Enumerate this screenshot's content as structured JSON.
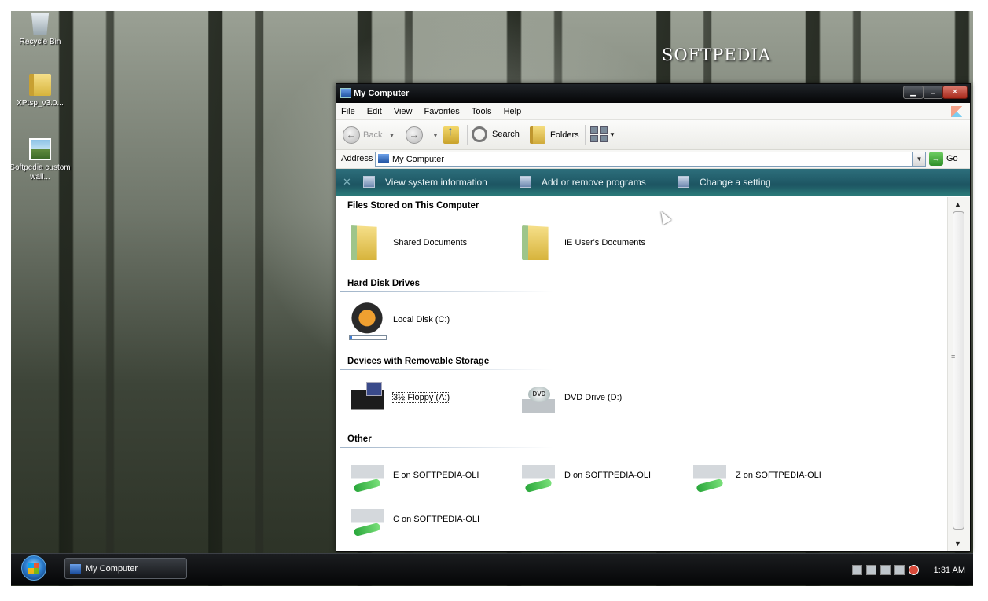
{
  "desktop": {
    "icons": [
      {
        "label": "Recycle Bin",
        "icon": "recycle-bin-icon"
      },
      {
        "label": "XPtsp_v3.0...",
        "icon": "zip-folder-icon"
      },
      {
        "label": "Softpedia custom wall...",
        "icon": "image-file-icon"
      }
    ],
    "brand": "SOFTPEDIA"
  },
  "window": {
    "title": "My Computer",
    "menu": [
      "File",
      "Edit",
      "View",
      "Favorites",
      "Tools",
      "Help"
    ],
    "toolbar": {
      "back_label": "Back",
      "search_label": "Search",
      "folders_label": "Folders"
    },
    "address": {
      "label": "Address",
      "value": "My Computer",
      "go_label": "Go"
    },
    "tasks": [
      {
        "label": "View system information",
        "icon": "system-info-icon"
      },
      {
        "label": "Add or remove programs",
        "icon": "add-remove-programs-icon"
      },
      {
        "label": "Change a setting",
        "icon": "control-panel-icon"
      }
    ],
    "sections": {
      "files": {
        "title": "Files Stored on This Computer",
        "items": [
          "Shared Documents",
          "IE User's Documents"
        ]
      },
      "hdd": {
        "title": "Hard Disk Drives",
        "items": [
          "Local Disk (C:)"
        ],
        "used_fraction": 0.06
      },
      "removable": {
        "title": "Devices with Removable Storage",
        "items": [
          "3½ Floppy (A:)",
          "DVD Drive (D:)"
        ]
      },
      "other": {
        "title": "Other",
        "items": [
          "E on SOFTPEDIA-OLI",
          "D on SOFTPEDIA-OLI",
          "Z on SOFTPEDIA-OLI",
          "C on SOFTPEDIA-OLI"
        ]
      }
    }
  },
  "taskbar": {
    "active_window": "My Computer",
    "clock": "1:31 AM"
  }
}
